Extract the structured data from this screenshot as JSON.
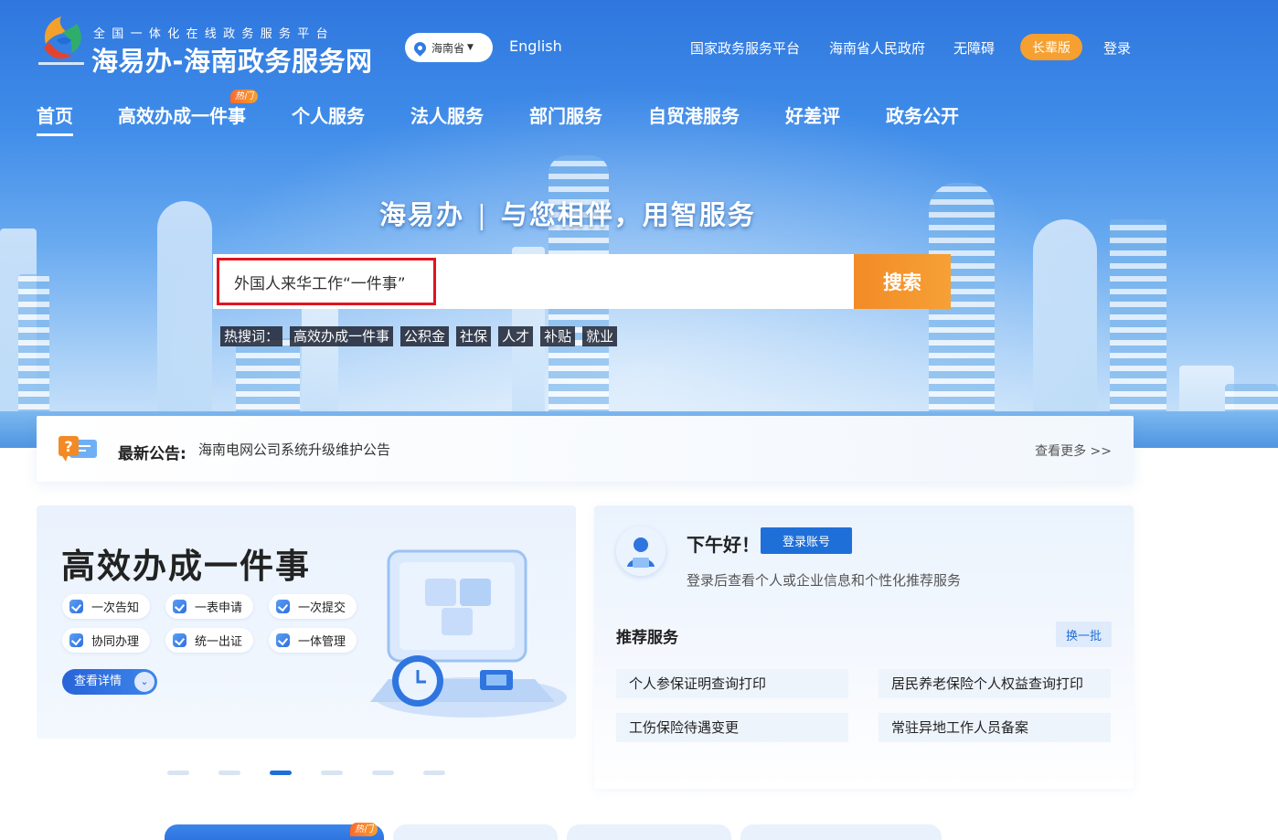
{
  "header": {
    "platform_subtitle": "全国一体化在线政务服务平台",
    "site_title": "海易办-海南政务服务网",
    "region": "海南省",
    "language": "English",
    "links": [
      "国家政务服务平台",
      "海南省人民政府",
      "无障碍"
    ],
    "elder_mode": "长辈版",
    "login": "登录"
  },
  "nav": {
    "items": [
      "首页",
      "高效办成一件事",
      "个人服务",
      "法人服务",
      "部门服务",
      "自贸港服务",
      "好差评",
      "政务公开"
    ],
    "active": "首页",
    "hot_badge": "热门"
  },
  "hero": {
    "slogan_brand": "海易办",
    "slogan_divider": "|",
    "slogan_text": "与您相伴，用智服务"
  },
  "search": {
    "query": "外国人来华工作“一件事”",
    "button": "搜索",
    "hot_label": "热搜词：",
    "hot_words": [
      "高效办成一件事",
      "公积金",
      "社保",
      "人才",
      "补贴",
      "就业"
    ]
  },
  "notice": {
    "label": "最新公告:",
    "text": "海南电网公司系统升级维护公告",
    "more": "查看更多 >>"
  },
  "promo": {
    "title": "高效办成一件事",
    "chips": [
      "一次告知",
      "一表申请",
      "一次提交",
      "协同办理",
      "统一出证",
      "一体管理"
    ],
    "detail_button": "查看详情",
    "slide_count": 6,
    "active_slide": 3
  },
  "user_panel": {
    "greeting": "下午好！",
    "login_button": "登录账号",
    "subtitle": "登录后查看个人或企业信息和个性化推荐服务",
    "recommend_title": "推荐服务",
    "swap_button": "换一批",
    "services": [
      "个人参保证明查询打印",
      "居民养老保险个人权益查询打印",
      "工伤保险待遇变更",
      "常驻异地工作人员备案"
    ]
  },
  "bottom": {
    "hot_badge": "热门"
  },
  "colors": {
    "primary": "#1f6fd8",
    "accent_orange": "#f28b26",
    "highlight_red": "#e0141e",
    "hero_blue": "#3f8ce9"
  }
}
